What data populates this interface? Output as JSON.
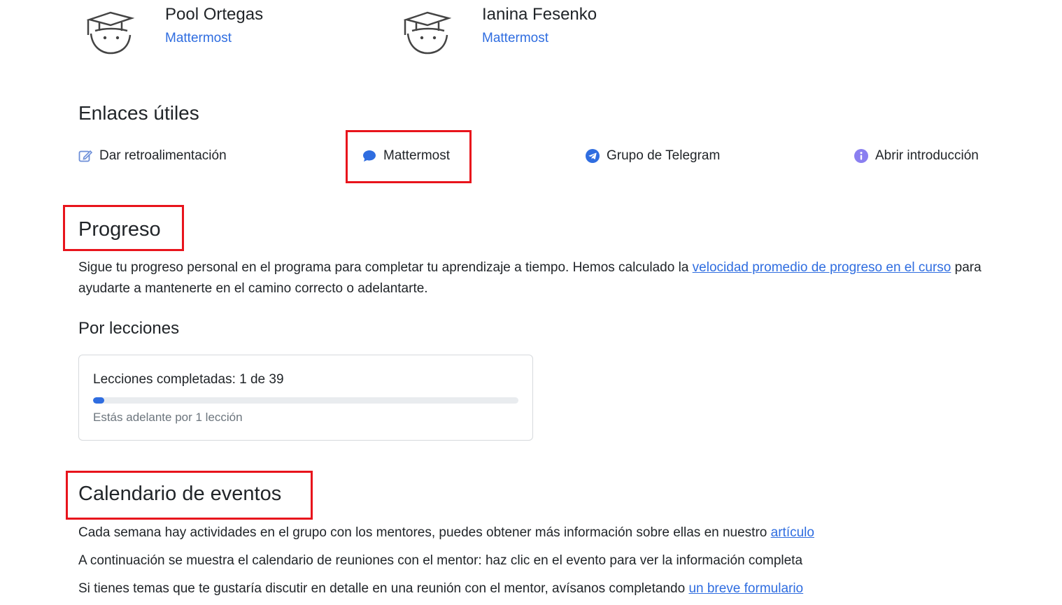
{
  "mentors": [
    {
      "name": "Pool Ortegas",
      "org": "Mattermost",
      "avatar_icon": "graduate-avatar-icon"
    },
    {
      "name": "Ianina Fesenko",
      "org": "Mattermost",
      "avatar_icon": "graduate-avatar-icon"
    }
  ],
  "links": {
    "title": "Enlaces útiles",
    "items": [
      {
        "label": "Dar retroalimentación",
        "icon": "edit-icon"
      },
      {
        "label": "Mattermost",
        "icon": "chat-bubble-icon"
      },
      {
        "label": "Grupo de Telegram",
        "icon": "telegram-icon"
      },
      {
        "label": "Abrir introducción",
        "icon": "info-icon"
      }
    ]
  },
  "progress": {
    "title": "Progreso",
    "text_before": "Sigue tu progreso personal en el programa para completar tu aprendizaje a tiempo. Hemos calculado la ",
    "link_text": "velocidad promedio de progreso en el curso",
    "text_after": " para ayudarte a mantenerte en el camino correcto o adelantarte.",
    "subtitle": "Por lecciones",
    "completed_label": "Lecciones completadas: 1 de 39",
    "completed": 1,
    "total": 39,
    "ahead_note": "Estás adelante por 1 lección"
  },
  "calendar": {
    "title": "Calendario de eventos",
    "line1_text": "Cada semana hay actividades en el grupo con los mentores, puedes obtener más información sobre ellas en nuestro ",
    "line1_link": "artículo",
    "line2_text": "A continuación se muestra el calendario de reuniones con el mentor: haz clic en el evento para ver la información completa",
    "line3_text": "Si tienes temas que te gustaría discutir en detalle en una reunión con el mentor, avísanos completando ",
    "line3_link": "un breve formulario"
  },
  "colors": {
    "accent": "#2f6de0",
    "highlight": "#e8141c",
    "telegram": "#2f6de0",
    "info": "#8a7ff0"
  }
}
